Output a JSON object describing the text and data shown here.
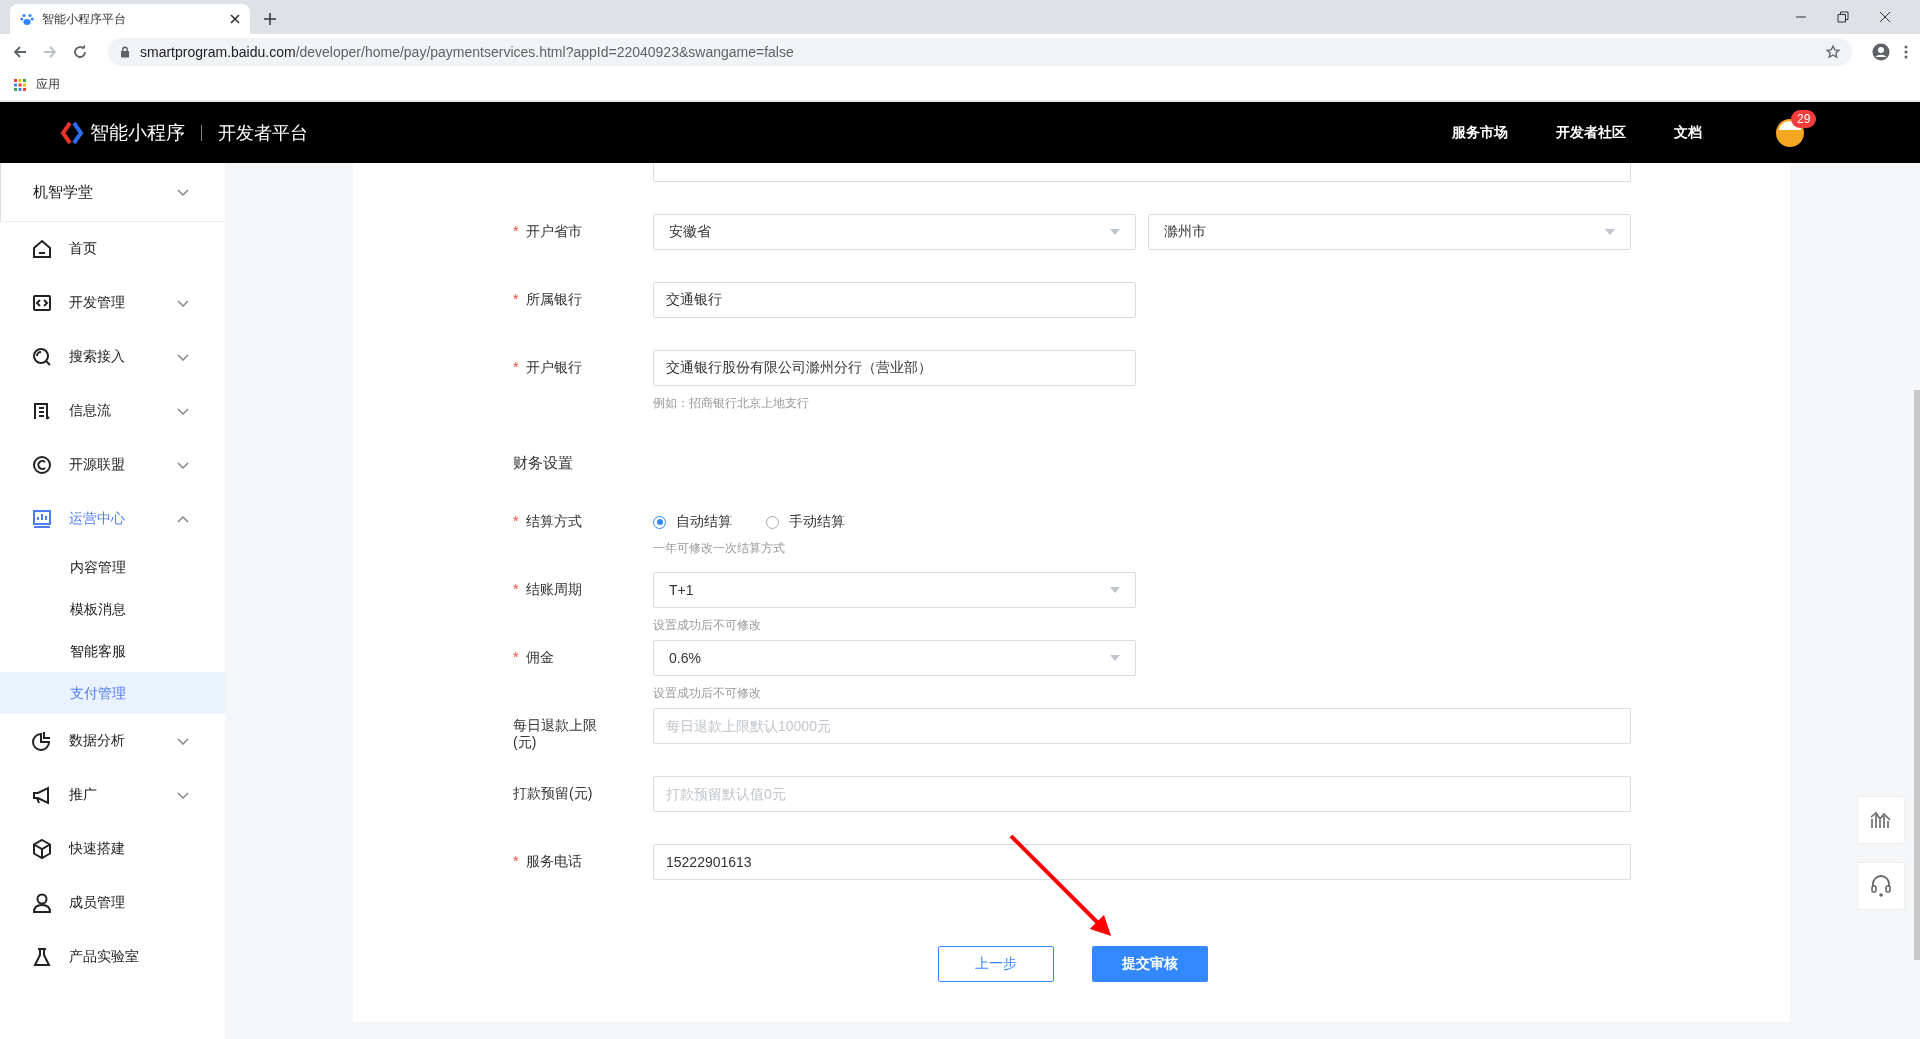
{
  "browser": {
    "tab_title": "智能小程序平台",
    "url_host": "smartprogram.baidu.com",
    "url_path": "/developer/home/pay/paymentservices.html?appId=22040923&swangame=false",
    "bookmarks": [
      "应用"
    ]
  },
  "header": {
    "logo_text": "智能小程序",
    "platform": "开发者平台",
    "nav": [
      "服务市场",
      "开发者社区",
      "文档"
    ],
    "badge": "29"
  },
  "sidebar": {
    "app_name": "机智学堂",
    "items": [
      {
        "label": "首页",
        "selected": false
      },
      {
        "label": "开发管理",
        "expanded": false,
        "selected": false
      },
      {
        "label": "搜索接入",
        "expanded": false,
        "selected": false
      },
      {
        "label": "信息流",
        "expanded": false,
        "selected": false
      },
      {
        "label": "开源联盟",
        "expanded": false,
        "selected": false
      },
      {
        "label": "运营中心",
        "expanded": true,
        "selected": false,
        "children": [
          {
            "label": "内容管理",
            "selected": false
          },
          {
            "label": "模板消息",
            "selected": false
          },
          {
            "label": "智能客服",
            "selected": false
          },
          {
            "label": "支付管理",
            "selected": true
          }
        ]
      },
      {
        "label": "数据分析",
        "expanded": false,
        "selected": false
      },
      {
        "label": "推广",
        "expanded": false,
        "selected": false
      },
      {
        "label": "快速搭建",
        "selected": false
      },
      {
        "label": "成员管理",
        "selected": false
      },
      {
        "label": "产品实验室",
        "selected": false
      }
    ]
  },
  "form": {
    "rows": [
      {
        "kind": "selectpair",
        "label": "开户省市",
        "marker": "*",
        "values": [
          "安徽省",
          "滁州市"
        ]
      },
      {
        "kind": "input",
        "label": "所属银行",
        "marker": "*",
        "value": "交通银行"
      },
      {
        "kind": "input",
        "label": "开户银行",
        "marker": "*",
        "value": "交通银行股份有限公司滁州分行（营业部）",
        "hint": "例如：招商银行北京上地支行"
      },
      {
        "kind": "section",
        "title": "财务设置"
      },
      {
        "kind": "radio",
        "label": "结算方式",
        "marker": "*",
        "options": [
          {
            "label": "自动结算",
            "selected": true
          },
          {
            "label": "手动结算",
            "selected": false
          }
        ],
        "hint": "一年可修改一次结算方式"
      },
      {
        "kind": "select",
        "label": "结账周期",
        "marker": "*",
        "value": "T+1",
        "hint": "设置成功后不可修改"
      },
      {
        "kind": "select",
        "label": "佣金",
        "marker": "*",
        "value": "0.6%",
        "hint": "设置成功后不可修改"
      },
      {
        "kind": "wideinput",
        "label": "每日退款上限(元)",
        "placeholder": "每日退款上限默认10000元"
      },
      {
        "kind": "wideinput",
        "label": "打款预留(元)",
        "placeholder": "打款预留默认值0元"
      },
      {
        "kind": "wideinput",
        "label": "服务电话",
        "marker": "*",
        "value": "15222901613"
      }
    ],
    "buttons": [
      {
        "label": "上一步",
        "kind": "secondary"
      },
      {
        "label": "提交审核",
        "kind": "primary"
      }
    ]
  }
}
